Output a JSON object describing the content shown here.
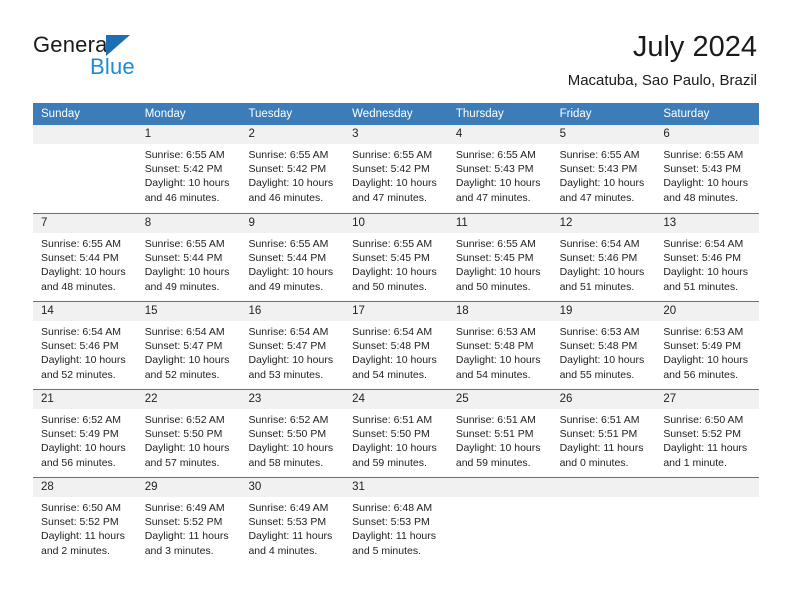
{
  "brand": {
    "word_one": "General",
    "word_two": "Blue",
    "accent_dark": "#1c6fb5",
    "accent_light": "#1f8ad6"
  },
  "header": {
    "month_title": "July 2024",
    "location": "Macatuba, Sao Paulo, Brazil"
  },
  "calendar": {
    "header_color": "#3b7cb9",
    "weekdays": [
      "Sunday",
      "Monday",
      "Tuesday",
      "Wednesday",
      "Thursday",
      "Friday",
      "Saturday"
    ],
    "weeks": [
      [
        {
          "day": "",
          "sunrise": "",
          "sunset": "",
          "daylight": "",
          "empty": true
        },
        {
          "day": "1",
          "sunrise": "Sunrise: 6:55 AM",
          "sunset": "Sunset: 5:42 PM",
          "daylight": "Daylight: 10 hours and 46 minutes."
        },
        {
          "day": "2",
          "sunrise": "Sunrise: 6:55 AM",
          "sunset": "Sunset: 5:42 PM",
          "daylight": "Daylight: 10 hours and 46 minutes."
        },
        {
          "day": "3",
          "sunrise": "Sunrise: 6:55 AM",
          "sunset": "Sunset: 5:42 PM",
          "daylight": "Daylight: 10 hours and 47 minutes."
        },
        {
          "day": "4",
          "sunrise": "Sunrise: 6:55 AM",
          "sunset": "Sunset: 5:43 PM",
          "daylight": "Daylight: 10 hours and 47 minutes."
        },
        {
          "day": "5",
          "sunrise": "Sunrise: 6:55 AM",
          "sunset": "Sunset: 5:43 PM",
          "daylight": "Daylight: 10 hours and 47 minutes."
        },
        {
          "day": "6",
          "sunrise": "Sunrise: 6:55 AM",
          "sunset": "Sunset: 5:43 PM",
          "daylight": "Daylight: 10 hours and 48 minutes."
        }
      ],
      [
        {
          "day": "7",
          "sunrise": "Sunrise: 6:55 AM",
          "sunset": "Sunset: 5:44 PM",
          "daylight": "Daylight: 10 hours and 48 minutes."
        },
        {
          "day": "8",
          "sunrise": "Sunrise: 6:55 AM",
          "sunset": "Sunset: 5:44 PM",
          "daylight": "Daylight: 10 hours and 49 minutes."
        },
        {
          "day": "9",
          "sunrise": "Sunrise: 6:55 AM",
          "sunset": "Sunset: 5:44 PM",
          "daylight": "Daylight: 10 hours and 49 minutes."
        },
        {
          "day": "10",
          "sunrise": "Sunrise: 6:55 AM",
          "sunset": "Sunset: 5:45 PM",
          "daylight": "Daylight: 10 hours and 50 minutes."
        },
        {
          "day": "11",
          "sunrise": "Sunrise: 6:55 AM",
          "sunset": "Sunset: 5:45 PM",
          "daylight": "Daylight: 10 hours and 50 minutes."
        },
        {
          "day": "12",
          "sunrise": "Sunrise: 6:54 AM",
          "sunset": "Sunset: 5:46 PM",
          "daylight": "Daylight: 10 hours and 51 minutes."
        },
        {
          "day": "13",
          "sunrise": "Sunrise: 6:54 AM",
          "sunset": "Sunset: 5:46 PM",
          "daylight": "Daylight: 10 hours and 51 minutes."
        }
      ],
      [
        {
          "day": "14",
          "sunrise": "Sunrise: 6:54 AM",
          "sunset": "Sunset: 5:46 PM",
          "daylight": "Daylight: 10 hours and 52 minutes."
        },
        {
          "day": "15",
          "sunrise": "Sunrise: 6:54 AM",
          "sunset": "Sunset: 5:47 PM",
          "daylight": "Daylight: 10 hours and 52 minutes."
        },
        {
          "day": "16",
          "sunrise": "Sunrise: 6:54 AM",
          "sunset": "Sunset: 5:47 PM",
          "daylight": "Daylight: 10 hours and 53 minutes."
        },
        {
          "day": "17",
          "sunrise": "Sunrise: 6:54 AM",
          "sunset": "Sunset: 5:48 PM",
          "daylight": "Daylight: 10 hours and 54 minutes."
        },
        {
          "day": "18",
          "sunrise": "Sunrise: 6:53 AM",
          "sunset": "Sunset: 5:48 PM",
          "daylight": "Daylight: 10 hours and 54 minutes."
        },
        {
          "day": "19",
          "sunrise": "Sunrise: 6:53 AM",
          "sunset": "Sunset: 5:48 PM",
          "daylight": "Daylight: 10 hours and 55 minutes."
        },
        {
          "day": "20",
          "sunrise": "Sunrise: 6:53 AM",
          "sunset": "Sunset: 5:49 PM",
          "daylight": "Daylight: 10 hours and 56 minutes."
        }
      ],
      [
        {
          "day": "21",
          "sunrise": "Sunrise: 6:52 AM",
          "sunset": "Sunset: 5:49 PM",
          "daylight": "Daylight: 10 hours and 56 minutes."
        },
        {
          "day": "22",
          "sunrise": "Sunrise: 6:52 AM",
          "sunset": "Sunset: 5:50 PM",
          "daylight": "Daylight: 10 hours and 57 minutes."
        },
        {
          "day": "23",
          "sunrise": "Sunrise: 6:52 AM",
          "sunset": "Sunset: 5:50 PM",
          "daylight": "Daylight: 10 hours and 58 minutes."
        },
        {
          "day": "24",
          "sunrise": "Sunrise: 6:51 AM",
          "sunset": "Sunset: 5:50 PM",
          "daylight": "Daylight: 10 hours and 59 minutes."
        },
        {
          "day": "25",
          "sunrise": "Sunrise: 6:51 AM",
          "sunset": "Sunset: 5:51 PM",
          "daylight": "Daylight: 10 hours and 59 minutes."
        },
        {
          "day": "26",
          "sunrise": "Sunrise: 6:51 AM",
          "sunset": "Sunset: 5:51 PM",
          "daylight": "Daylight: 11 hours and 0 minutes."
        },
        {
          "day": "27",
          "sunrise": "Sunrise: 6:50 AM",
          "sunset": "Sunset: 5:52 PM",
          "daylight": "Daylight: 11 hours and 1 minute."
        }
      ],
      [
        {
          "day": "28",
          "sunrise": "Sunrise: 6:50 AM",
          "sunset": "Sunset: 5:52 PM",
          "daylight": "Daylight: 11 hours and 2 minutes."
        },
        {
          "day": "29",
          "sunrise": "Sunrise: 6:49 AM",
          "sunset": "Sunset: 5:52 PM",
          "daylight": "Daylight: 11 hours and 3 minutes."
        },
        {
          "day": "30",
          "sunrise": "Sunrise: 6:49 AM",
          "sunset": "Sunset: 5:53 PM",
          "daylight": "Daylight: 11 hours and 4 minutes."
        },
        {
          "day": "31",
          "sunrise": "Sunrise: 6:48 AM",
          "sunset": "Sunset: 5:53 PM",
          "daylight": "Daylight: 11 hours and 5 minutes."
        },
        {
          "day": "",
          "sunrise": "",
          "sunset": "",
          "daylight": "",
          "empty": true
        },
        {
          "day": "",
          "sunrise": "",
          "sunset": "",
          "daylight": "",
          "empty": true
        },
        {
          "day": "",
          "sunrise": "",
          "sunset": "",
          "daylight": "",
          "empty": true
        }
      ]
    ]
  }
}
